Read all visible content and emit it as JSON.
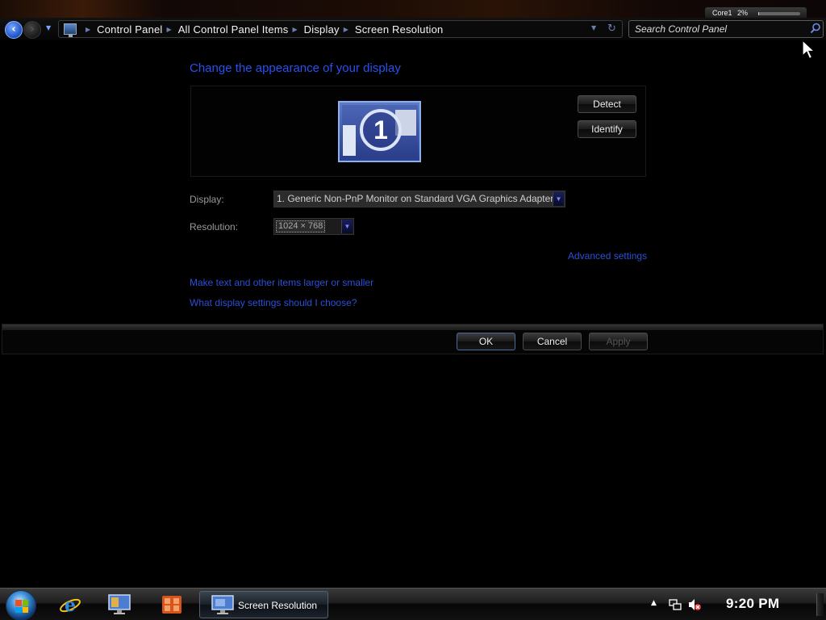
{
  "gadget": {
    "label": "Core1",
    "percent": "2%",
    "usage": 0.02
  },
  "navigation": {
    "breadcrumbs": [
      "Control Panel",
      "All Control Panel Items",
      "Display",
      "Screen Resolution"
    ]
  },
  "search": {
    "placeholder": "Search Control Panel"
  },
  "page": {
    "heading": "Change the appearance of your display",
    "monitor_number": "1",
    "detect_label": "Detect",
    "identify_label": "Identify",
    "display_label": "Display:",
    "display_value": "1. Generic Non-PnP Monitor on Standard VGA Graphics Adapter",
    "resolution_label": "Resolution:",
    "resolution_value": "1024 × 768",
    "advanced_settings": "Advanced settings",
    "link_text_size": "Make text and other items larger or smaller",
    "link_help": "What display settings should I choose?"
  },
  "actions": {
    "ok": "OK",
    "cancel": "Cancel",
    "apply": "Apply"
  },
  "taskbar": {
    "active_window": "Screen Resolution",
    "clock": "9:20 PM"
  },
  "colors": {
    "heading_blue": "#2a50ef",
    "link_blue": "#2c4fd8",
    "background": "#000000"
  }
}
